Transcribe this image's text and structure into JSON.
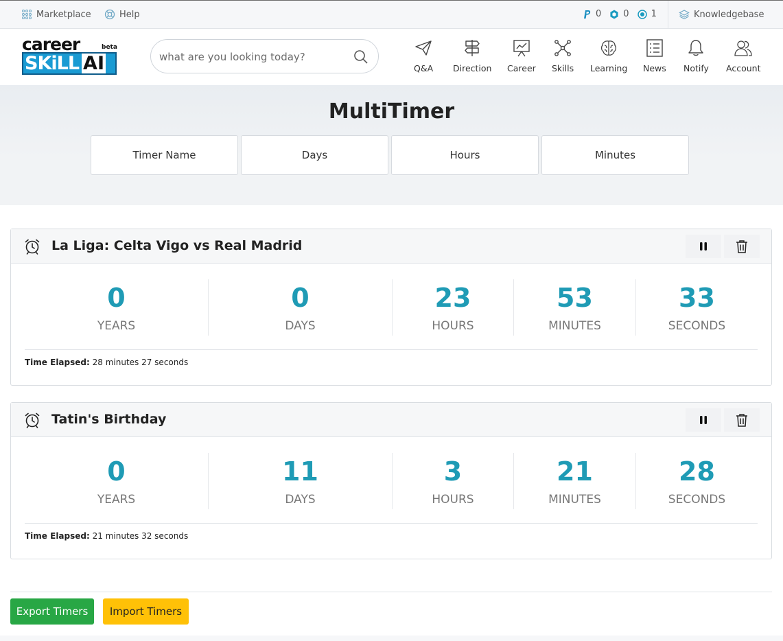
{
  "topbar": {
    "marketplace_label": "Marketplace",
    "help_label": "Help",
    "points": [
      {
        "icon": "paypal-p-icon",
        "value": "0"
      },
      {
        "icon": "hexagon-icon",
        "value": "0"
      },
      {
        "icon": "target-icon",
        "value": "1"
      }
    ],
    "knowledgebase_label": "Knowledgebase"
  },
  "header": {
    "logo": {
      "career": "career",
      "skill": "SKiLL",
      "ai": "AI",
      "beta": "beta"
    },
    "search": {
      "placeholder": "what are you looking today?",
      "value": ""
    },
    "nav": [
      {
        "label": "Q&A",
        "icon": "paper-plane-icon"
      },
      {
        "label": "Direction",
        "icon": "signpost-icon"
      },
      {
        "label": "Career",
        "icon": "presentation-chart-icon"
      },
      {
        "label": "Skills",
        "icon": "network-nodes-icon"
      },
      {
        "label": "Learning",
        "icon": "brain-icon"
      },
      {
        "label": "News",
        "icon": "list-document-icon"
      },
      {
        "label": "Notify",
        "icon": "bell-icon"
      },
      {
        "label": "Account",
        "icon": "users-icon"
      }
    ]
  },
  "hero": {
    "title": "MultiTimer",
    "fields": [
      {
        "placeholder": "Timer Name"
      },
      {
        "placeholder": "Days"
      },
      {
        "placeholder": "Hours"
      },
      {
        "placeholder": "Minutes"
      }
    ]
  },
  "timers": [
    {
      "title": "La Liga: Celta Vigo vs Real Madrid",
      "stats": [
        {
          "value": "0",
          "label": "Years"
        },
        {
          "value": "0",
          "label": "Days"
        },
        {
          "value": "23",
          "label": "Hours"
        },
        {
          "value": "53",
          "label": "Minutes"
        },
        {
          "value": "33",
          "label": "Seconds"
        }
      ],
      "elapsed_label": "Time Elapsed:",
      "elapsed_value": "28 minutes 27 seconds"
    },
    {
      "title": "Tatin's Birthday",
      "stats": [
        {
          "value": "0",
          "label": "Years"
        },
        {
          "value": "11",
          "label": "Days"
        },
        {
          "value": "3",
          "label": "Hours"
        },
        {
          "value": "21",
          "label": "Minutes"
        },
        {
          "value": "28",
          "label": "Seconds"
        }
      ],
      "elapsed_label": "Time Elapsed:",
      "elapsed_value": "21 minutes 32 seconds"
    }
  ],
  "actions": {
    "export_label": "Export Timers",
    "import_label": "Import Timers"
  },
  "colors": {
    "accent_teal": "#1f9bb5",
    "export_green": "#28a745",
    "import_yellow": "#ffc107"
  }
}
